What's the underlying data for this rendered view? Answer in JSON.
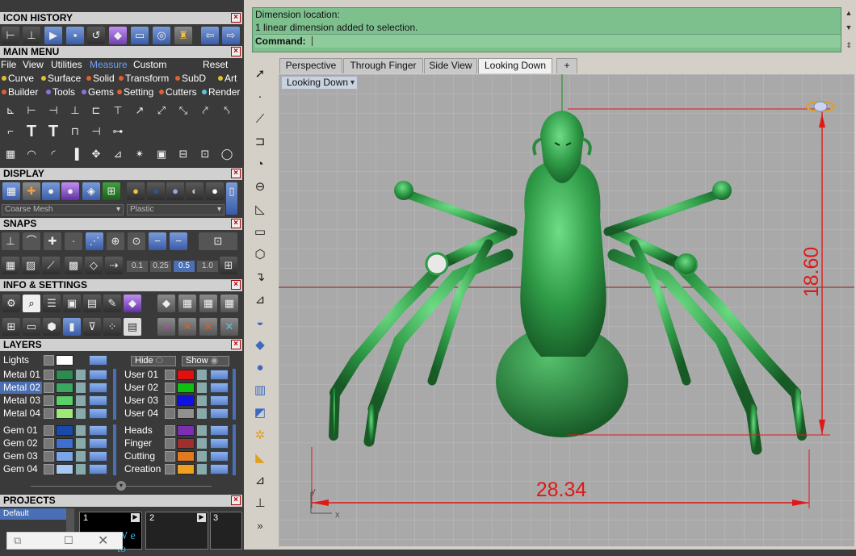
{
  "icon_history": {
    "title": "ICON HISTORY"
  },
  "main_menu": {
    "title": "MAIN MENU",
    "items": [
      "File",
      "View",
      "Utilities",
      "Measure",
      "Custom",
      "Reset"
    ],
    "categories_row1": [
      "Curve",
      "Surface",
      "Solid",
      "Transform",
      "SubD",
      "Art"
    ],
    "categories_row2": [
      "Builder",
      "Tools",
      "Gems",
      "Setting",
      "Cutters",
      "Render"
    ]
  },
  "display": {
    "title": "DISPLAY",
    "mesh_select": "Coarse Mesh",
    "material_select": "Plastic"
  },
  "snaps": {
    "title": "SNAPS",
    "values": [
      "0.1",
      "0.25",
      "0.5",
      "1.0"
    ]
  },
  "info_settings": {
    "title": "INFO & SETTINGS"
  },
  "layers": {
    "title": "LAYERS",
    "lights_label": "Lights",
    "hide_label": "Hide",
    "show_label": "Show",
    "left_groups": [
      [
        "Metal 01",
        "Metal 02",
        "Metal 03",
        "Metal 04"
      ],
      [
        "Gem 01",
        "Gem 02",
        "Gem 03",
        "Gem 04"
      ]
    ],
    "right_groups": [
      [
        "User 01",
        "User 02",
        "User 03",
        "User 04"
      ],
      [
        "Heads",
        "Finger",
        "Cutting",
        "Creation"
      ]
    ],
    "left_colors": [
      [
        "#2e8a50",
        "#3aa860",
        "#5bcf6a",
        "#9ee87a"
      ],
      [
        "#1a4aa8",
        "#3e6ed0",
        "#7aa6e8",
        "#a8c8f0"
      ]
    ],
    "right_colors": [
      [
        "#e01010",
        "#10c010",
        "#1010e0",
        "#909090"
      ],
      [
        "#7a30b0",
        "#a02e2e",
        "#e07a20",
        "#f0a020"
      ]
    ]
  },
  "projects": {
    "title": "PROJECTS",
    "default_label": "Default",
    "slots": [
      "1",
      "2",
      "3"
    ],
    "thumb_text": "W  e to"
  },
  "command": {
    "line1": "Dimension location:",
    "line2": "1 linear dimension added to selection.",
    "prompt": "Command:"
  },
  "tabs": [
    "Perspective",
    "Through Finger",
    "Side View",
    "Looking Down",
    "+"
  ],
  "active_tab": "Looking Down",
  "viewport": {
    "label": "Looking Down",
    "dim_width": "28.34",
    "dim_height": "18.60",
    "axis_x": "x",
    "axis_y": "y",
    "model_color": "#2e9a46",
    "dim_color": "#e01818"
  },
  "toolbar_more": "»",
  "colors": {
    "panel_header": "#d0d0d0",
    "command_bg": "#7ebf8e",
    "viewport_bg": "#a9a9a9",
    "highlight": "#4a6fb5"
  }
}
